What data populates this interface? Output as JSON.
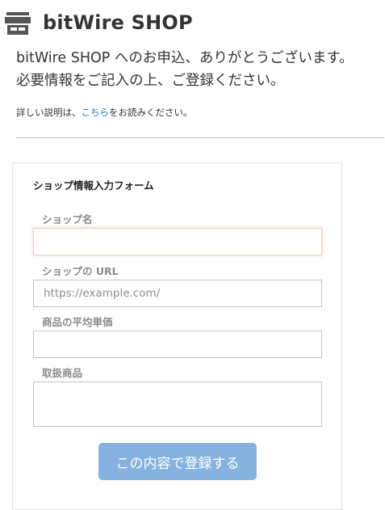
{
  "header": {
    "brand": "bitWire SHOP",
    "icon": "shop-icon",
    "icon_color": "#555555"
  },
  "intro": {
    "line1": "bitWire SHOP へのお申込、ありがとうございます。",
    "line2": "必要情報をご記入の上、ご登録ください。"
  },
  "help": {
    "prefix": "詳しい説明は、",
    "link": "こちら",
    "suffix": "をお読みください。",
    "link_color": "#1a7fc1"
  },
  "form": {
    "title": "ショップ情報入力フォーム",
    "fields": [
      {
        "label": "ショップ名",
        "value": "",
        "placeholder": ""
      },
      {
        "label": "ショップの URL",
        "value": "",
        "placeholder": "https://example.com/"
      },
      {
        "label": "商品の平均単価",
        "value": "",
        "placeholder": ""
      },
      {
        "label": "取扱商品",
        "value": "",
        "placeholder": ""
      }
    ],
    "submit_label": "この内容で登録する",
    "submit_color": "#86b2df"
  }
}
